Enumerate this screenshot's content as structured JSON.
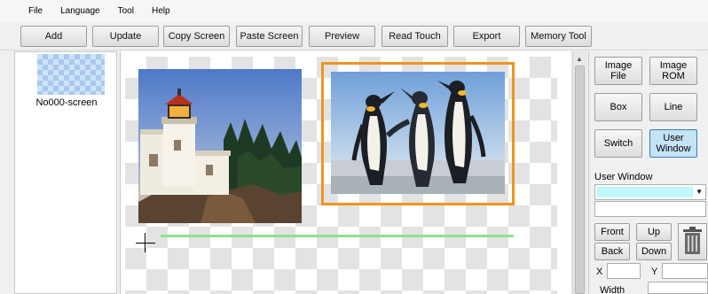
{
  "menu": [
    "File",
    "Language",
    "Tool",
    "Help"
  ],
  "toolbar": {
    "buttons": [
      "Add",
      "Update",
      "Copy Screen",
      "Paste Screen",
      "Preview",
      "Read Touch",
      "Export",
      "Memory Tool"
    ]
  },
  "screens": [
    {
      "label": "No000-screen"
    }
  ],
  "panel": {
    "buttons": [
      "Image\nFile",
      "Image\nROM",
      "Box",
      "Line",
      "Switch",
      "User\nWindow"
    ],
    "active": "User Window",
    "user_window_label": "User Window",
    "order_buttons": [
      "Front",
      "Up",
      "Back",
      "Down"
    ],
    "x_label": "X",
    "y_label": "Y",
    "width_label": "Width"
  },
  "icons": [
    "lighthouse-image",
    "penguins-image",
    "trash-icon",
    "crosshair-icon",
    "chevron-down-icon",
    "scroll-up-icon"
  ],
  "colors": {
    "selection_border": "#f0941f",
    "guide_line": "#8fe08f",
    "active_button": "#c4e3f5",
    "combo_highlight": "#bff7fb"
  }
}
